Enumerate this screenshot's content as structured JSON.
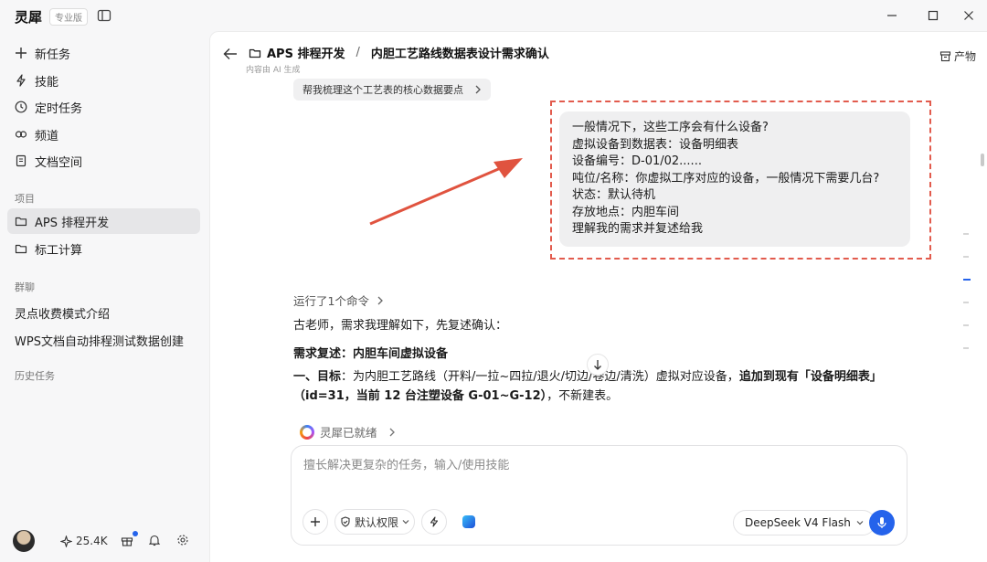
{
  "app": {
    "name": "灵犀",
    "edition_badge": "专业版"
  },
  "sidebar": {
    "nav": [
      {
        "label": "新任务",
        "icon": "plus-icon"
      },
      {
        "label": "技能",
        "icon": "bolt-icon"
      },
      {
        "label": "定时任务",
        "icon": "clock-icon"
      },
      {
        "label": "频道",
        "icon": "link-icon"
      },
      {
        "label": "文档空间",
        "icon": "document-icon"
      }
    ],
    "projects_title": "项目",
    "projects": [
      {
        "label": "APS 排程开发",
        "icon": "folder-icon",
        "active": true
      },
      {
        "label": "标工计算",
        "icon": "folder-icon",
        "active": false
      }
    ],
    "groups_title": "群聊",
    "groups": [
      "灵点收费模式介绍",
      "WPS文档自动排程测试数据创建"
    ],
    "history_title": "历史任务",
    "footer": {
      "credits": "25.4K"
    }
  },
  "header": {
    "project": "APS 排程开发",
    "separator": "/",
    "title": "内胆工艺路线数据表设计需求确认",
    "subnote": "内容由 AI 生成",
    "products_label": "产物"
  },
  "chat": {
    "suggestion_chip": "帮我梳理这个工艺表的核心数据要点",
    "user_message_lines": [
      "一般情况下，这些工序会有什么设备?",
      "虚拟设备到数据表：设备明细表",
      "设备编号：D-01/02......",
      "吨位/名称：你虚拟工序对应的设备，一般情况下需要几台?",
      "状态：默认待机",
      "存放地点：内胆车间",
      "理解我的需求并复述给我"
    ],
    "command_summary": "运行了1个命令",
    "reply_intro": "古老师，需求我理解如下，先复述确认：",
    "reply_heading": "需求复述：内胆车间虚拟设备",
    "goal_label": "一、目标",
    "goal_text": "：为内胆工艺路线（开料/一拉~四拉/退火/切边/卷边/清洗）虚拟对应设备，",
    "goal_bold": "追加到现有「设备明细表」（id=31，当前 12 台注塑设备 G-01~G-12）",
    "goal_tail": "，不新建表。",
    "status": "灵犀已就绪"
  },
  "composer": {
    "placeholder": "擅长解决更复杂的任务，输入/使用技能",
    "permission_label": "默认权限",
    "model_label": "DeepSeek V4 Flash"
  },
  "colors": {
    "accent": "#2563eb",
    "highlight_border": "#e25b4d",
    "arrow": "#e0533f"
  }
}
